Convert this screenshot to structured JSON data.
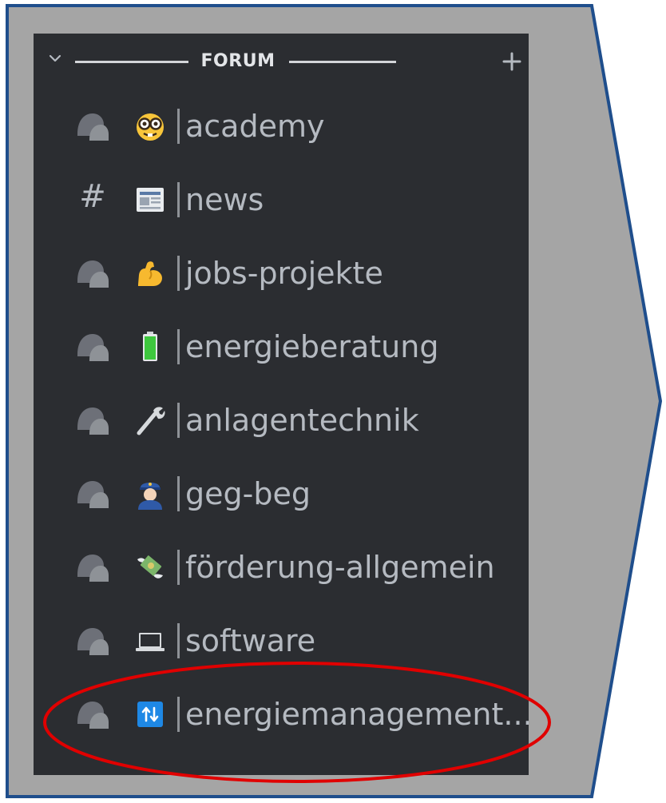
{
  "category": {
    "title": "FORUM",
    "collapse_icon": "chevron-down-icon",
    "add_icon": "plus-icon"
  },
  "channels": [
    {
      "name": "academy",
      "type_icon": "forum-icon",
      "emoji": "nerd-face-icon"
    },
    {
      "name": "news",
      "type_icon": "hash-icon",
      "emoji": "newspaper-icon"
    },
    {
      "name": "jobs-projekte",
      "type_icon": "forum-icon",
      "emoji": "flexed-biceps-icon"
    },
    {
      "name": "energieberatung",
      "type_icon": "forum-icon",
      "emoji": "battery-icon"
    },
    {
      "name": "anlagentechnik",
      "type_icon": "forum-icon",
      "emoji": "wrench-icon"
    },
    {
      "name": "geg-beg",
      "type_icon": "forum-icon",
      "emoji": "police-officer-icon"
    },
    {
      "name": "förderung-allgemein",
      "type_icon": "forum-icon",
      "emoji": "money-with-wings-icon"
    },
    {
      "name": "software",
      "type_icon": "forum-icon",
      "emoji": "laptop-icon"
    },
    {
      "name": "energiemanagement...",
      "type_icon": "forum-icon",
      "emoji": "arrows-clockwise-icon"
    }
  ],
  "hash_glyph": "#",
  "separator_glyph": "|",
  "colors": {
    "frame_fill": "#a5a5a5",
    "frame_border": "#1f4e8c",
    "panel_bg": "#2b2d31",
    "text": "#b5bac1",
    "highlight": "#e00000"
  }
}
